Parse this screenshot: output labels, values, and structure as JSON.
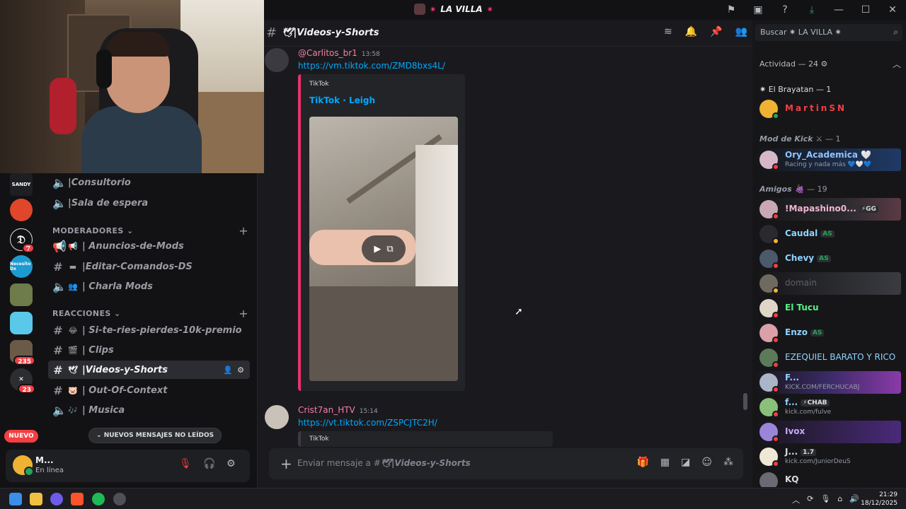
{
  "window": {
    "server_title": "LA VILLA",
    "spark": "✷"
  },
  "rail": {
    "badges": [
      "7",
      "235",
      "23"
    ],
    "server_labels": {
      "sandy": "SANDY",
      "necesitodx": "Necesito Dx"
    },
    "nuevo": "NUEVO"
  },
  "channels": {
    "top": [
      {
        "name": "|Consultorio",
        "emoji": "🔈"
      },
      {
        "name": "|Sala de espera",
        "emoji": "🔈"
      }
    ],
    "categories": [
      {
        "label": "MODERADORES",
        "chevron": "⌄"
      },
      {
        "label": "REACCIONES",
        "chevron": "⌄"
      }
    ],
    "mods": [
      {
        "name": "| Anuncios-de-Mods",
        "emoji": "📢"
      },
      {
        "name": "|Editar-Comandos-DS",
        "emoji": "▬"
      },
      {
        "name": "| Charla Mods",
        "emoji": "👥"
      }
    ],
    "reacciones": [
      {
        "name": "| Si-te-ries-pierdes-10k-premio",
        "emoji": "😂"
      },
      {
        "name": "| Clips",
        "emoji": "🎬"
      },
      {
        "name": "|Videos-y-Shorts",
        "emoji": "🕊"
      },
      {
        "name": "| Out-Of-Context",
        "emoji": "🐷"
      },
      {
        "name": "| Musica",
        "emoji": "🎶"
      }
    ],
    "unread_pill": "NUEVOS MENSAJES NO LEÍDOS"
  },
  "user": {
    "name": "M...",
    "status": "En línea"
  },
  "chat": {
    "channel": "🕊|Videos-y-Shorts",
    "messages": [
      {
        "author": "@Carlitos_br1",
        "time": "13:58",
        "link": "https://vm.tiktok.com/ZMD8bxs4L/",
        "embed": {
          "provider": "TikTok",
          "title": "TikTok · Leigh"
        }
      },
      {
        "author": "Crist7an_HTV",
        "time": "15:14",
        "link": "https://vt.tiktok.com/ZSPCJTC2H/",
        "embed": {
          "provider": "TikTok"
        }
      }
    ],
    "composer_placeholder_prefix": "Enviar mensaje a #",
    "composer_channel": "🕊|Videos-y-Shorts"
  },
  "members": {
    "search_placeholder": "Buscar ✷ LA VILLA ✷",
    "activity": "Actividad — 24 ⚙",
    "groups": [
      {
        "label": "✷ El Brayatan",
        "count": "— 1"
      },
      {
        "label": "Mod de Kick ⚔",
        "count": "— 1"
      },
      {
        "label": "Amigos 🍇",
        "count": "— 19"
      }
    ],
    "list": [
      {
        "name": "MartinSN",
        "color": "#f23f43"
      },
      {
        "name": "Ory_Academica 🤍",
        "sub": "Racing y nada más 💙🤍💙",
        "color": "#5ea0ff"
      },
      {
        "name": "!Mapashino0...",
        "tag": "⚡GG",
        "color": "#f0b4d0"
      },
      {
        "name": "Caudal",
        "tag": "AS",
        "color": "#8fd3ff"
      },
      {
        "name": "Chevy",
        "tag": "AS",
        "color": "#8fd3ff"
      },
      {
        "name": "domain",
        "color": "#5d6069"
      },
      {
        "name": "El Tucu",
        "color": "#57f287"
      },
      {
        "name": "Enzo",
        "tag": "AS",
        "color": "#8fd3ff"
      },
      {
        "name": "EZEQUIEL BARATO Y RICO",
        "color": "#8fd3ff"
      },
      {
        "name": "F...",
        "sub": "KICK.COM/FERCHUCABJ",
        "color": "#8fd3ff"
      },
      {
        "name": "f...",
        "tag": "⚡CHAB",
        "sub": "kick.com/fulve",
        "color": "#8fd3ff"
      },
      {
        "name": "Ivox",
        "color": "#c9a6ff"
      },
      {
        "name": "J...",
        "tag": "1.7",
        "sub": "kick.com/JuniorDeuS",
        "color": "#dbdee1"
      },
      {
        "name": "KQ",
        "color": "#dbdee1"
      }
    ]
  },
  "taskbar": {
    "time": "21:29",
    "date": "18/12/2025"
  },
  "colors": {
    "accent_pink": "#e8336b",
    "link_blue": "#00a8fc",
    "online_green": "#23a55a",
    "dnd_red": "#f23f43"
  }
}
